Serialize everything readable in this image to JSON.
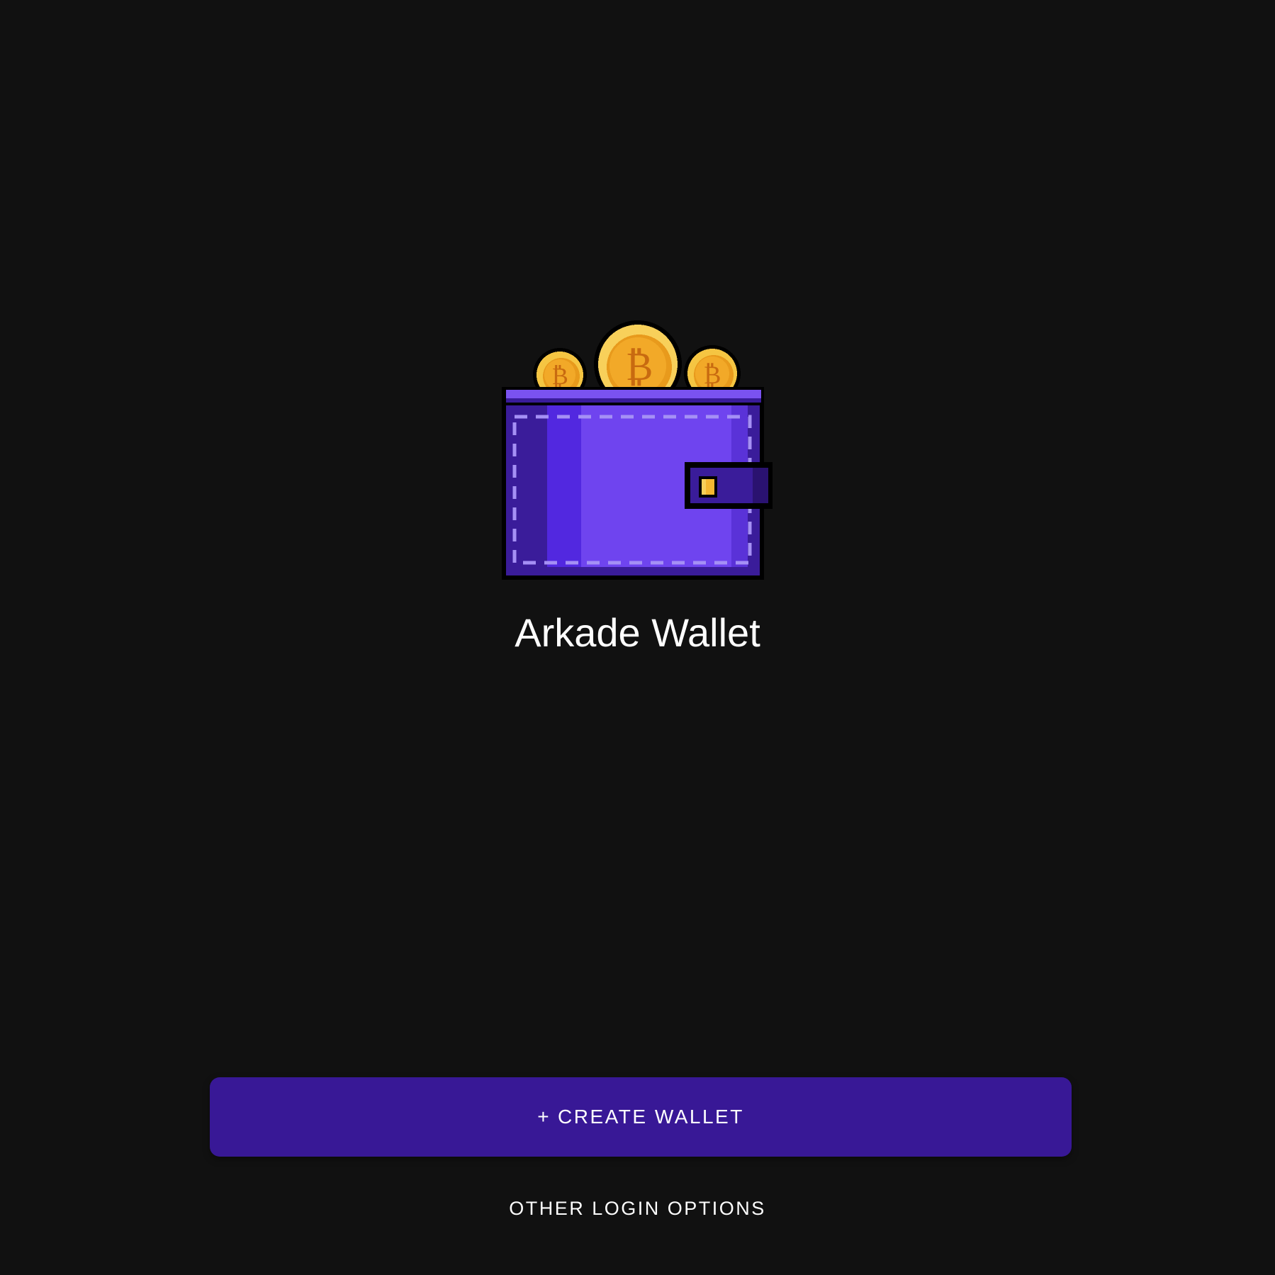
{
  "app": {
    "title": "Arkade Wallet",
    "logo_icon": "pixel-wallet-with-bitcoin-coins-icon"
  },
  "actions": {
    "create_plus": "+",
    "create_label": "CREATE WALLET",
    "other_options_label": "OTHER LOGIN OPTIONS"
  },
  "colors": {
    "background": "#111111",
    "primary_button": "#381896",
    "wallet_purple": "#6f44ef",
    "coin_gold": "#f5b731"
  }
}
